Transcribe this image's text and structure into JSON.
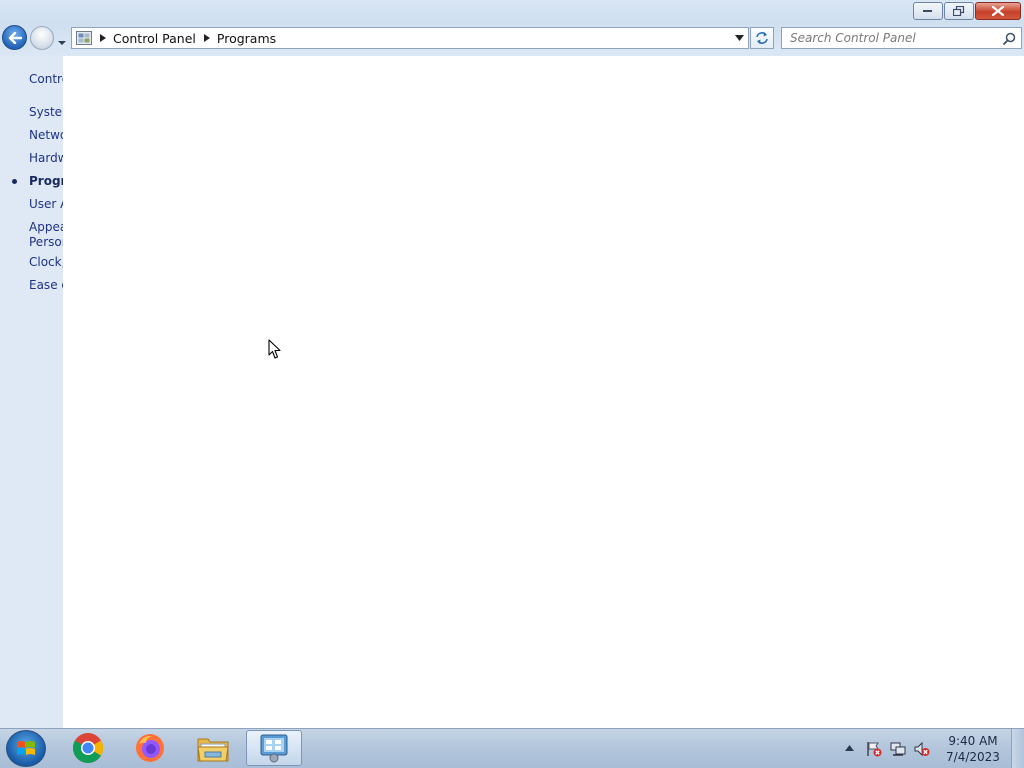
{
  "window": {
    "caption": {
      "minimize_icon": "minimize-icon",
      "maximize_icon": "restore-icon",
      "close_icon": "close-icon"
    }
  },
  "navigation": {
    "breadcrumb": [
      "Control Panel",
      "Programs"
    ],
    "search_placeholder": "Search Control Panel"
  },
  "sidebar": {
    "items": [
      {
        "label": "Contro",
        "active": false
      },
      {
        "label": "System",
        "active": false
      },
      {
        "label": "Netwo",
        "active": false
      },
      {
        "label": "Hardw",
        "active": false
      },
      {
        "label": "Progra",
        "active": true
      },
      {
        "label": "User A",
        "active": false
      },
      {
        "label": "Appea",
        "active": false
      },
      {
        "label": "Person",
        "active": false
      },
      {
        "label": "Clock,",
        "active": false
      },
      {
        "label": "Ease o",
        "active": false
      }
    ]
  },
  "taskbar": {
    "apps": [
      {
        "name": "chrome-icon"
      },
      {
        "name": "firefox-icon"
      },
      {
        "name": "file-explorer-icon"
      },
      {
        "name": "control-panel-icon",
        "active": true
      }
    ],
    "tray_icons": [
      "action-center-flag-icon",
      "network-icon",
      "volume-muted-icon"
    ],
    "clock": {
      "time": "9:40 AM",
      "date": "7/4/2023"
    }
  },
  "colors": {
    "sidebar_bg": "#dfe9f5",
    "link": "#1e3287",
    "main_bg": "#ffffff"
  }
}
